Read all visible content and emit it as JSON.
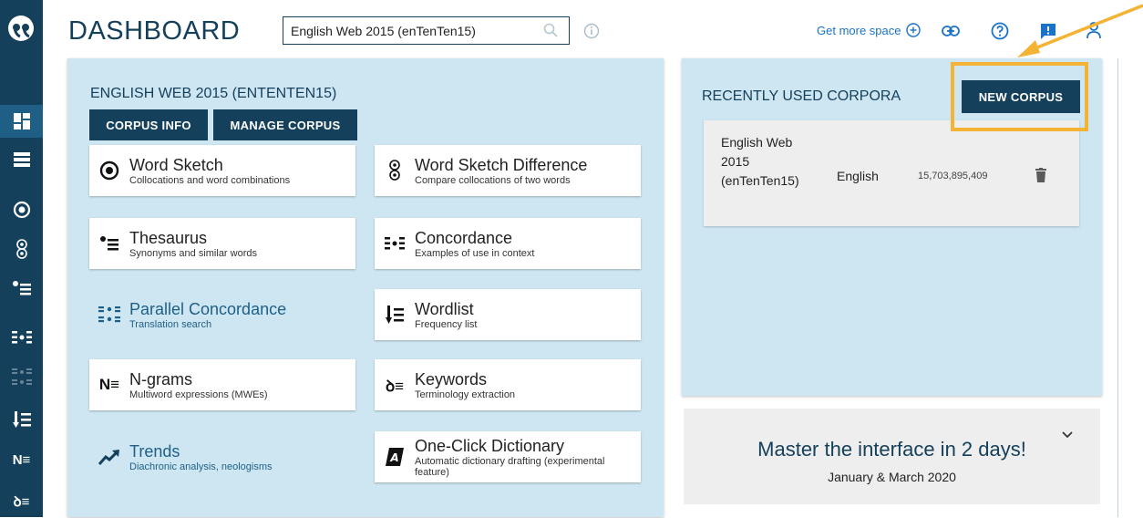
{
  "header": {
    "title": "DASHBOARD",
    "search_value": "English Web 2015 (enTenTen15)",
    "get_more_space": "Get more space"
  },
  "sidebar": {
    "items": [
      {
        "icon": "dashboard-icon",
        "active": true
      },
      {
        "icon": "list-icon"
      },
      {
        "icon": "word-sketch-icon"
      },
      {
        "icon": "word-sketch-difference-icon"
      },
      {
        "icon": "thesaurus-icon"
      },
      {
        "icon": "concordance-icon"
      },
      {
        "icon": "parallel-concordance-icon"
      },
      {
        "icon": "wordlist-icon"
      },
      {
        "icon": "ngrams-icon",
        "text": "N≡"
      },
      {
        "icon": "keywords-icon",
        "text": "ꝺ≡"
      }
    ]
  },
  "corpus_panel": {
    "title": "ENGLISH WEB 2015 (ENTENTEN15)",
    "corpus_info_label": "CORPUS INFO",
    "manage_corpus_label": "MANAGE CORPUS",
    "tools": [
      {
        "name": "Word Sketch",
        "desc": "Collocations and word combinations"
      },
      {
        "name": "Word Sketch Difference",
        "desc": "Compare collocations of two words"
      },
      {
        "name": "Thesaurus",
        "desc": "Synonyms and similar words"
      },
      {
        "name": "Concordance",
        "desc": "Examples of use in context"
      },
      {
        "name": "Parallel Concordance",
        "desc": "Translation search"
      },
      {
        "name": "Wordlist",
        "desc": "Frequency list"
      },
      {
        "name": "N-grams",
        "desc": "Multiword expressions (MWEs)"
      },
      {
        "name": "Keywords",
        "desc": "Terminology extraction"
      },
      {
        "name": "Trends",
        "desc": "Diachronic analysis, neologisms"
      },
      {
        "name": "One-Click Dictionary",
        "desc": "Automatic dictionary drafting (experimental feature)"
      }
    ]
  },
  "recent_panel": {
    "title": "RECENTLY USED CORPORA",
    "new_corpus_label": "NEW CORPUS",
    "rows": [
      {
        "name": "English Web 2015 (enTenTen15)",
        "language": "English",
        "size": "15,703,895,409"
      }
    ]
  },
  "promo": {
    "title": "Master the interface in 2 days!",
    "subtitle": "January & March 2020"
  },
  "colors": {
    "navy": "#15405b",
    "panel": "#cde6f2",
    "highlight": "#f5b335",
    "link": "#1a73c8"
  }
}
